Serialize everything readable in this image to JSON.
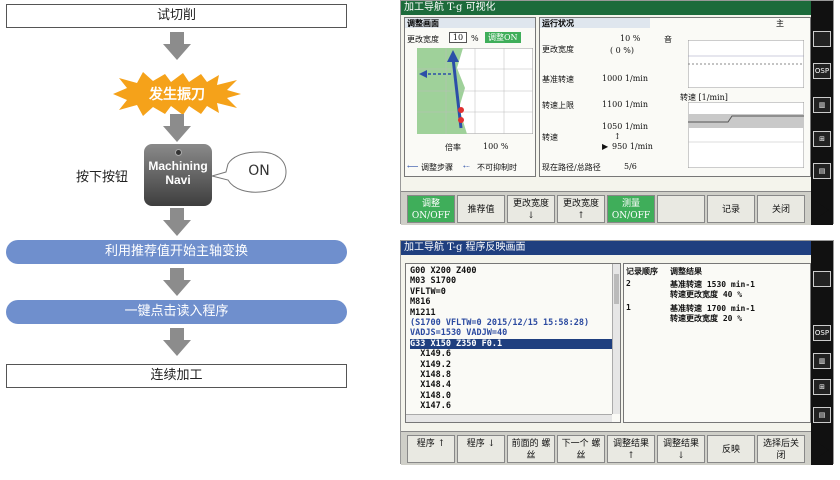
{
  "flow": {
    "trial_cut": "试切削",
    "chatter": "发生振刀",
    "press": "按下按钮",
    "button_line1": "Machining",
    "button_line2": "Navi",
    "on": "ON",
    "step_spindle": "利用推荐值开始主轴变换",
    "step_load": "一键点击读入程序",
    "continue": "连续加工"
  },
  "colors": {
    "accent": "#6f8fcd",
    "burst": "#f5a21a",
    "screen_title": "#1c6b3b",
    "select_blue": "#1f3f7f"
  },
  "screen1": {
    "title": "加工导航 T-g 可视化",
    "panel_adjust": "调整画面",
    "change_width_label": "更改宽度",
    "change_width_value": "10",
    "change_width_unit": "%",
    "adjust_on": "调整ON",
    "ratio_label": "倍率",
    "ratio_value": "100 %",
    "legend_adjust": "调整步骤",
    "legend_uncontrol": "不可抑制时",
    "panel_run": "运行状况",
    "change_width2_label": "更改宽度",
    "change_width2_value": "10 %",
    "change_width2_sub": "( 0 %)",
    "base_speed_label": "基准转速",
    "base_speed_value": "1000 1/min",
    "speed_limit_label": "转速上限",
    "speed_limit_value": "1100 1/min",
    "speed_label": "转速",
    "speed_value1": "1050 1/min",
    "speed_value2": "950 1/min",
    "path_label": "现在路径/总路径",
    "path_value": "5/6",
    "sound_label": "音",
    "speed_chart_label": "转速 [1/min]",
    "main_label": "主",
    "softkeys": [
      "调整 ON/OFF",
      "推荐值",
      "更改宽度 ↓",
      "更改宽度 ↑",
      "测量 ON/OFF",
      "",
      "记录",
      "关闭"
    ]
  },
  "screen2": {
    "title": "加工导航 T-g 程序反映画面",
    "program_lines": [
      "G00 X200 Z400",
      "M03 S1700",
      "VFLTW=0",
      "M816",
      "M1211",
      "(S1700 VFLTW=0 2015/12/15 15:58:28)",
      "VADJS=1530 VADJW=40",
      "G33 X150 Z350 F0.1",
      "  X149.6",
      "  X149.2",
      "  X148.8",
      "  X148.4",
      "  X148.0",
      "  X147.6"
    ],
    "log_headers": [
      "记录顺序",
      "调整结果"
    ],
    "log_rows": [
      {
        "order": "2",
        "line1": "基准转速 1530 min-1",
        "line2": "转速更改宽度 40 %"
      },
      {
        "order": "1",
        "line1": "基准转速 1700 min-1",
        "line2": "转速更改宽度 20 %"
      }
    ],
    "softkeys": [
      "程序 ↑",
      "程序 ↓",
      "前面的 螺丝",
      "下一个 螺丝",
      "调整结果 ↑",
      "调整结果 ↓",
      "反映",
      "选择后关 闭"
    ]
  }
}
